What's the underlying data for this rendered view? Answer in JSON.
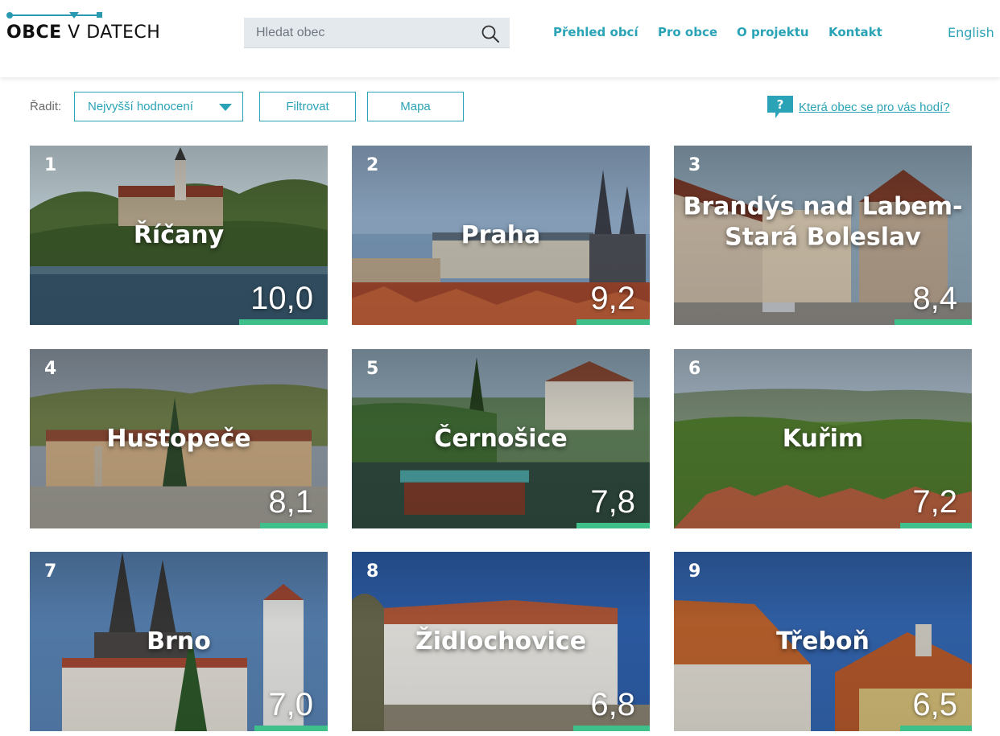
{
  "header": {
    "logo_bold": "OBCE",
    "logo_rest": " V DATECH",
    "search_placeholder": "Hledat obec",
    "nav": [
      "Přehled obcí",
      "Pro obce",
      "O projektu",
      "Kontakt"
    ],
    "language": "English"
  },
  "toolbar": {
    "sort_label": "Řadit:",
    "sort_value": "Nejvyšší hodnocení",
    "filter_label": "Filtrovat",
    "map_label": "Mapa",
    "help_icon_text": "?",
    "help_link": "Která obec se pro vás hodí?"
  },
  "colors": {
    "accent": "#2aa3b6",
    "score_bar": "#3fbf8a"
  },
  "cards": [
    {
      "rank": "1",
      "name": "Říčany",
      "score": "10,0",
      "score_value": 10.0,
      "image": "town-photo-lake-church"
    },
    {
      "rank": "2",
      "name": "Praha",
      "score": "9,2",
      "score_value": 9.2,
      "image": "town-photo-castle-rooftops"
    },
    {
      "rank": "3",
      "name": "Brandýs nad Labem-Stará Boleslav",
      "score": "8,4",
      "score_value": 8.4,
      "image": "town-photo-street-church"
    },
    {
      "rank": "4",
      "name": "Hustopeče",
      "score": "8,1",
      "score_value": 8.1,
      "image": "town-photo-square-column"
    },
    {
      "rank": "5",
      "name": "Černošice",
      "score": "7,8",
      "score_value": 7.8,
      "image": "town-photo-river-boat"
    },
    {
      "rank": "6",
      "name": "Kuřim",
      "score": "7,2",
      "score_value": 7.2,
      "image": "town-photo-aerial-green"
    },
    {
      "rank": "7",
      "name": "Brno",
      "score": "7,0",
      "score_value": 7.0,
      "image": "town-photo-cathedral"
    },
    {
      "rank": "8",
      "name": "Židlochovice",
      "score": "6,8",
      "score_value": 6.8,
      "image": "town-photo-chateau"
    },
    {
      "rank": "9",
      "name": "Třeboň",
      "score": "6,5",
      "score_value": 6.5,
      "image": "town-photo-rooftops"
    }
  ]
}
